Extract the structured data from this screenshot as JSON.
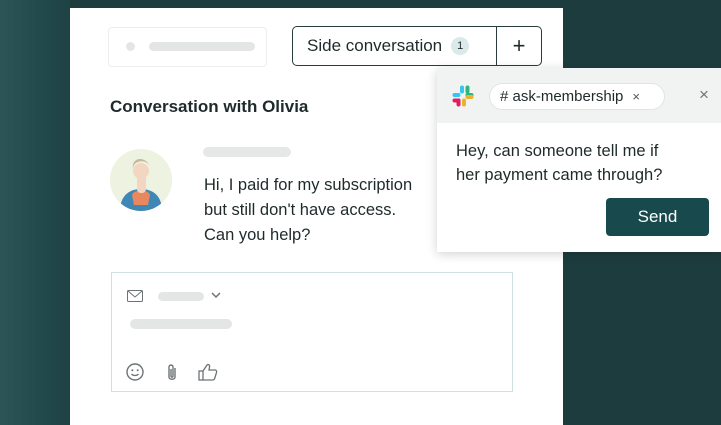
{
  "header": {
    "side_conversation": {
      "label": "Side conversation",
      "count": "1",
      "add_label": "+"
    }
  },
  "conversation": {
    "title": "Conversation with Olivia",
    "message": "Hi, I paid for my subscription\nbut still don't have access.\nCan you help?"
  },
  "popover": {
    "channel": "# ask-membership",
    "channel_remove": "×",
    "close": "×",
    "message": "Hey, can someone tell me if\nher payment came through?",
    "send_label": "Send"
  },
  "composer": {
    "icons": [
      "mail-icon",
      "chevron-down-icon",
      "emoji-icon",
      "attachment-icon",
      "thumbs-up-icon"
    ]
  },
  "colors": {
    "background": "#1d3c3e",
    "accent": "#17494d",
    "slack_red": "#e01e5a",
    "slack_blue": "#36c5f0",
    "slack_green": "#2eb67d",
    "slack_yellow": "#ecb22e"
  }
}
